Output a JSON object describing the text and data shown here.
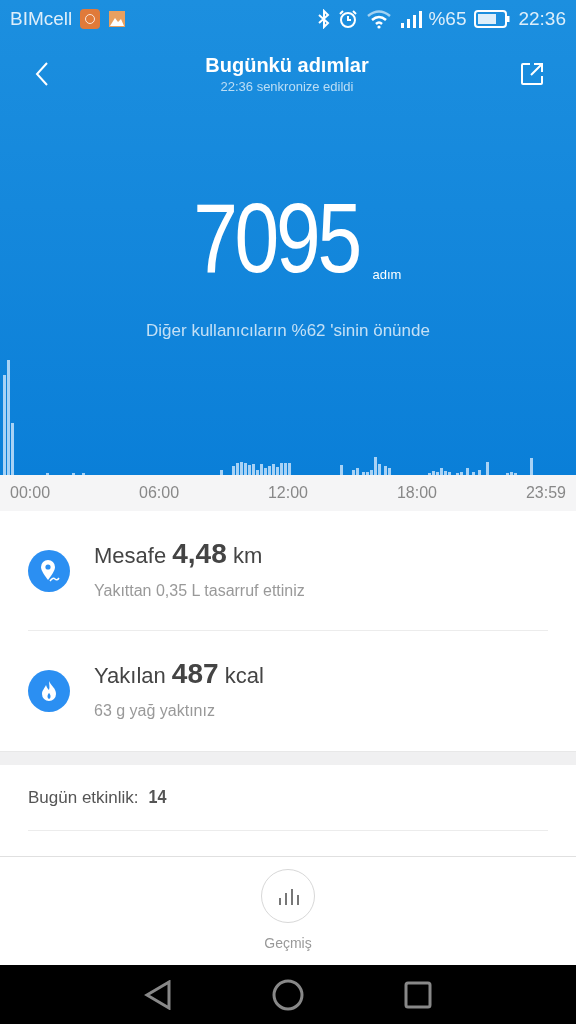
{
  "status_bar": {
    "carrier": "BIMcell",
    "battery_text": "%65",
    "time": "22:36"
  },
  "header": {
    "title": "Bugünkü adımlar",
    "subtitle": "22:36 senkronize edildi"
  },
  "summary": {
    "steps": "7095",
    "unit": "adım",
    "comparison": "Diğer kullanıcıların %62 'sinin önünde"
  },
  "chart": {
    "x_labels": [
      "00:00",
      "06:00",
      "12:00",
      "18:00",
      "23:59"
    ]
  },
  "stats": [
    {
      "kind": "distance",
      "headline": "Mesafe **4,48** km",
      "detail": "Yakıttan 0,35 L tasarruf ettiniz"
    },
    {
      "kind": "calories",
      "headline": "Yakılan **487** kcal",
      "detail": "63 g yağ yaktınız"
    }
  ],
  "activity": {
    "label": "Bugün etkinlik:",
    "value": "14"
  },
  "bottom_action": {
    "label": "Geçmiş"
  }
}
